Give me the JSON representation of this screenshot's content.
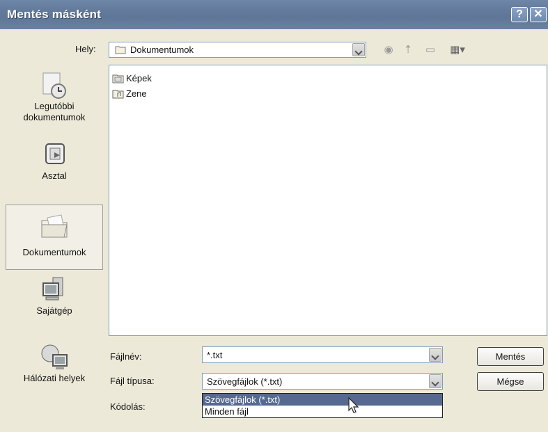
{
  "window": {
    "title": "Mentés másként",
    "help_label": "?",
    "close_label": "✕"
  },
  "location": {
    "label": "Hely:",
    "value": "Dokumentumok"
  },
  "toolbar": {
    "icons": [
      "back-icon",
      "up-folder-icon",
      "new-folder-icon",
      "view-menu-icon"
    ]
  },
  "places": [
    {
      "label": "Legutóbbi dokumentumok",
      "icon": "recent-documents-icon"
    },
    {
      "label": "Asztal",
      "icon": "desktop-icon"
    },
    {
      "label": "Dokumentumok",
      "icon": "my-documents-icon",
      "selected": true
    },
    {
      "label": "Sajátgép",
      "icon": "my-computer-icon"
    },
    {
      "label": "Hálózati helyek",
      "icon": "network-places-icon"
    }
  ],
  "files": [
    {
      "name": "Képek",
      "icon": "pictures-folder-icon"
    },
    {
      "name": "Zene",
      "icon": "music-folder-icon"
    }
  ],
  "form": {
    "filename_label": "Fájlnév:",
    "filename_value": "*.txt",
    "filetype_label": "Fájl típusa:",
    "filetype_value": "Szövegfájlok (*.txt)",
    "encoding_label": "Kódolás:",
    "filetype_options": [
      "Szövegfájlok (*.txt)",
      "Minden fájl"
    ]
  },
  "buttons": {
    "save": "Mentés",
    "cancel": "Mégse"
  }
}
